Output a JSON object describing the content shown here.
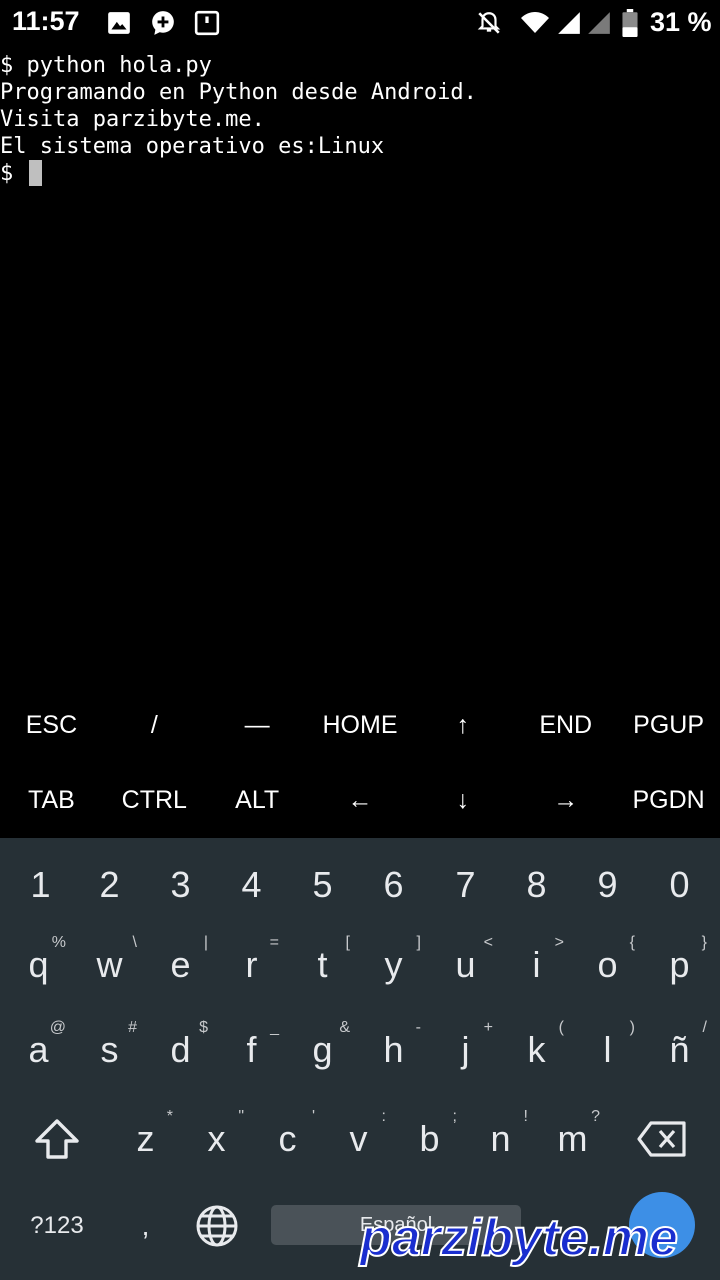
{
  "status_bar": {
    "time": "11:57",
    "battery_text": "31 %",
    "icons": [
      "image-icon",
      "chat-add-icon",
      "notification-square-icon",
      "notifications-off-icon",
      "wifi-icon",
      "signal-icon",
      "signal-secondary-icon",
      "battery-icon"
    ]
  },
  "terminal": {
    "lines": [
      "$ python hola.py",
      "Programando en Python desde Android.",
      "Visita parzibyte.me.",
      "El sistema operativo es:Linux"
    ],
    "prompt": "$ "
  },
  "extra_keys": {
    "row1": [
      "ESC",
      "/",
      "—",
      "HOME",
      "↑",
      "END",
      "PGUP"
    ],
    "row2": [
      "TAB",
      "CTRL",
      "ALT",
      "←",
      "↓",
      "→",
      "PGDN"
    ]
  },
  "keyboard": {
    "numbers": [
      "1",
      "2",
      "3",
      "4",
      "5",
      "6",
      "7",
      "8",
      "9",
      "0"
    ],
    "row_q": [
      {
        "k": "q",
        "h": "%"
      },
      {
        "k": "w",
        "h": "\\"
      },
      {
        "k": "e",
        "h": "|"
      },
      {
        "k": "r",
        "h": "="
      },
      {
        "k": "t",
        "h": "["
      },
      {
        "k": "y",
        "h": "]"
      },
      {
        "k": "u",
        "h": "<"
      },
      {
        "k": "i",
        "h": ">"
      },
      {
        "k": "o",
        "h": "{"
      },
      {
        "k": "p",
        "h": "}"
      }
    ],
    "row_a": [
      {
        "k": "a",
        "h": "@"
      },
      {
        "k": "s",
        "h": "#"
      },
      {
        "k": "d",
        "h": "$"
      },
      {
        "k": "f",
        "h": "_"
      },
      {
        "k": "g",
        "h": "&"
      },
      {
        "k": "h",
        "h": "-"
      },
      {
        "k": "j",
        "h": "+"
      },
      {
        "k": "k",
        "h": "("
      },
      {
        "k": "l",
        "h": ")"
      },
      {
        "k": "ñ",
        "h": "/"
      }
    ],
    "row_z": [
      {
        "k": "z",
        "h": "*"
      },
      {
        "k": "x",
        "h": "\""
      },
      {
        "k": "c",
        "h": "'"
      },
      {
        "k": "v",
        "h": ":"
      },
      {
        "k": "b",
        "h": ";"
      },
      {
        "k": "n",
        "h": "!"
      },
      {
        "k": "m",
        "h": "?"
      }
    ],
    "symbols_key": "?123",
    "comma_key": ",",
    "space_label": "Español",
    "colors": {
      "background": "#263036",
      "enter": "#3d8fe6"
    }
  },
  "watermark": "parzibyte.me"
}
